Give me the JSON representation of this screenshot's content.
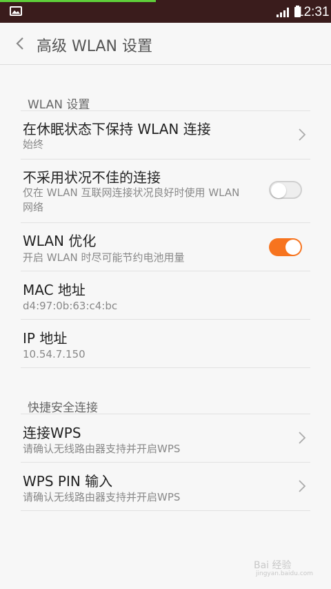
{
  "status_bar": {
    "time": "12:31",
    "icons": [
      "photo-icon",
      "signal-icon",
      "battery-icon"
    ],
    "progress_fraction": 0.47
  },
  "header": {
    "title": "高级 WLAN 设置",
    "back_icon": "chevron-left-icon"
  },
  "sections": {
    "wlan": {
      "title": "WLAN 设置",
      "items": [
        {
          "label": "在休眠状态下保持 WLAN 连接",
          "sub": "始终",
          "control": "chevron-right-icon"
        },
        {
          "label": "不采用状况不佳的连接",
          "sub": "仅在 WLAN 互联网连接状况良好时使用 WLAN 网络",
          "toggle": false
        },
        {
          "label": "WLAN 优化",
          "sub": "开启 WLAN 时尽可能节约电池用量",
          "toggle": true
        },
        {
          "label": "MAC 地址",
          "sub": "d4:97:0b:63:c4:bc"
        },
        {
          "label": "IP 地址",
          "sub": "10.54.7.150"
        }
      ]
    },
    "wps": {
      "title": "快捷安全连接",
      "items": [
        {
          "label": "连接WPS",
          "sub": "请确认无线路由器支持并开启WPS",
          "control": "chevron-right-icon"
        },
        {
          "label": "WPS PIN 输入",
          "sub": "请确认无线路由器支持并开启WPS",
          "control": "chevron-right-icon"
        }
      ]
    }
  },
  "colors": {
    "accent": "#f7741f",
    "status_bar_bg": "#3a1c1c",
    "background": "#f7f7f7"
  },
  "watermark": {
    "text": "Bai 经验",
    "sub": "jingyan.baidu.com"
  }
}
